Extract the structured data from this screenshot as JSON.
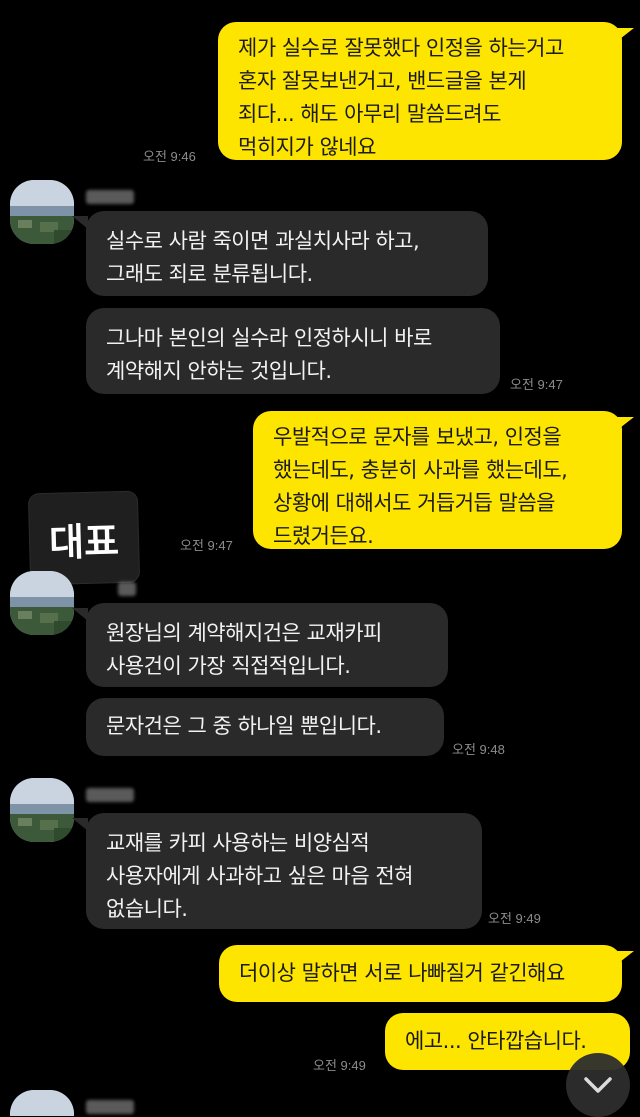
{
  "messages": {
    "m1": {
      "text": "제가 실수로 잘못했다 인정을 하는거고\n혼자 잘못보낸거고, 밴드글을 본게\n죄다... 해도 아무리 말씀드려도\n먹히지가 않네요",
      "time": "오전 9:46"
    },
    "m2": {
      "text": "실수로 사람 죽이면 과실치사라 하고,\n그래도 죄로 분류됩니다."
    },
    "m3": {
      "text": "그나마 본인의 실수라 인정하시니 바로\n계약해지 안하는 것입니다.",
      "time": "오전 9:47"
    },
    "m4": {
      "text": "우발적으로 문자를 보냈고, 인정을\n했는데도, 충분히 사과를 했는데도,\n상황에 대해서도 거듭거듭 말씀을\n드렸거든요.",
      "time": "오전 9:47"
    },
    "m5": {
      "text": "원장님의 계약해지건은 교재카피\n사용건이 가장 직접적입니다."
    },
    "m6": {
      "text": "문자건은 그 중 하나일 뿐입니다.",
      "time": "오전 9:48"
    },
    "m7": {
      "text": "교재를 카피 사용하는 비양심적\n사용자에게 사과하고 싶은 마음 전혀\n없습니다.",
      "time": "오전 9:49"
    },
    "m8": {
      "text": "더이상 말하면 서로 나빠질거 같긴해요"
    },
    "m9": {
      "text": "에고... 안타깝습니다.",
      "time": "오전 9:49"
    }
  },
  "sticker": {
    "label": "대표"
  },
  "icons": {
    "scroll_down": "chevron-down-icon"
  },
  "colors": {
    "mine_bubble": "#fee500",
    "their_bubble": "#2a2a2a",
    "background": "#000000"
  }
}
